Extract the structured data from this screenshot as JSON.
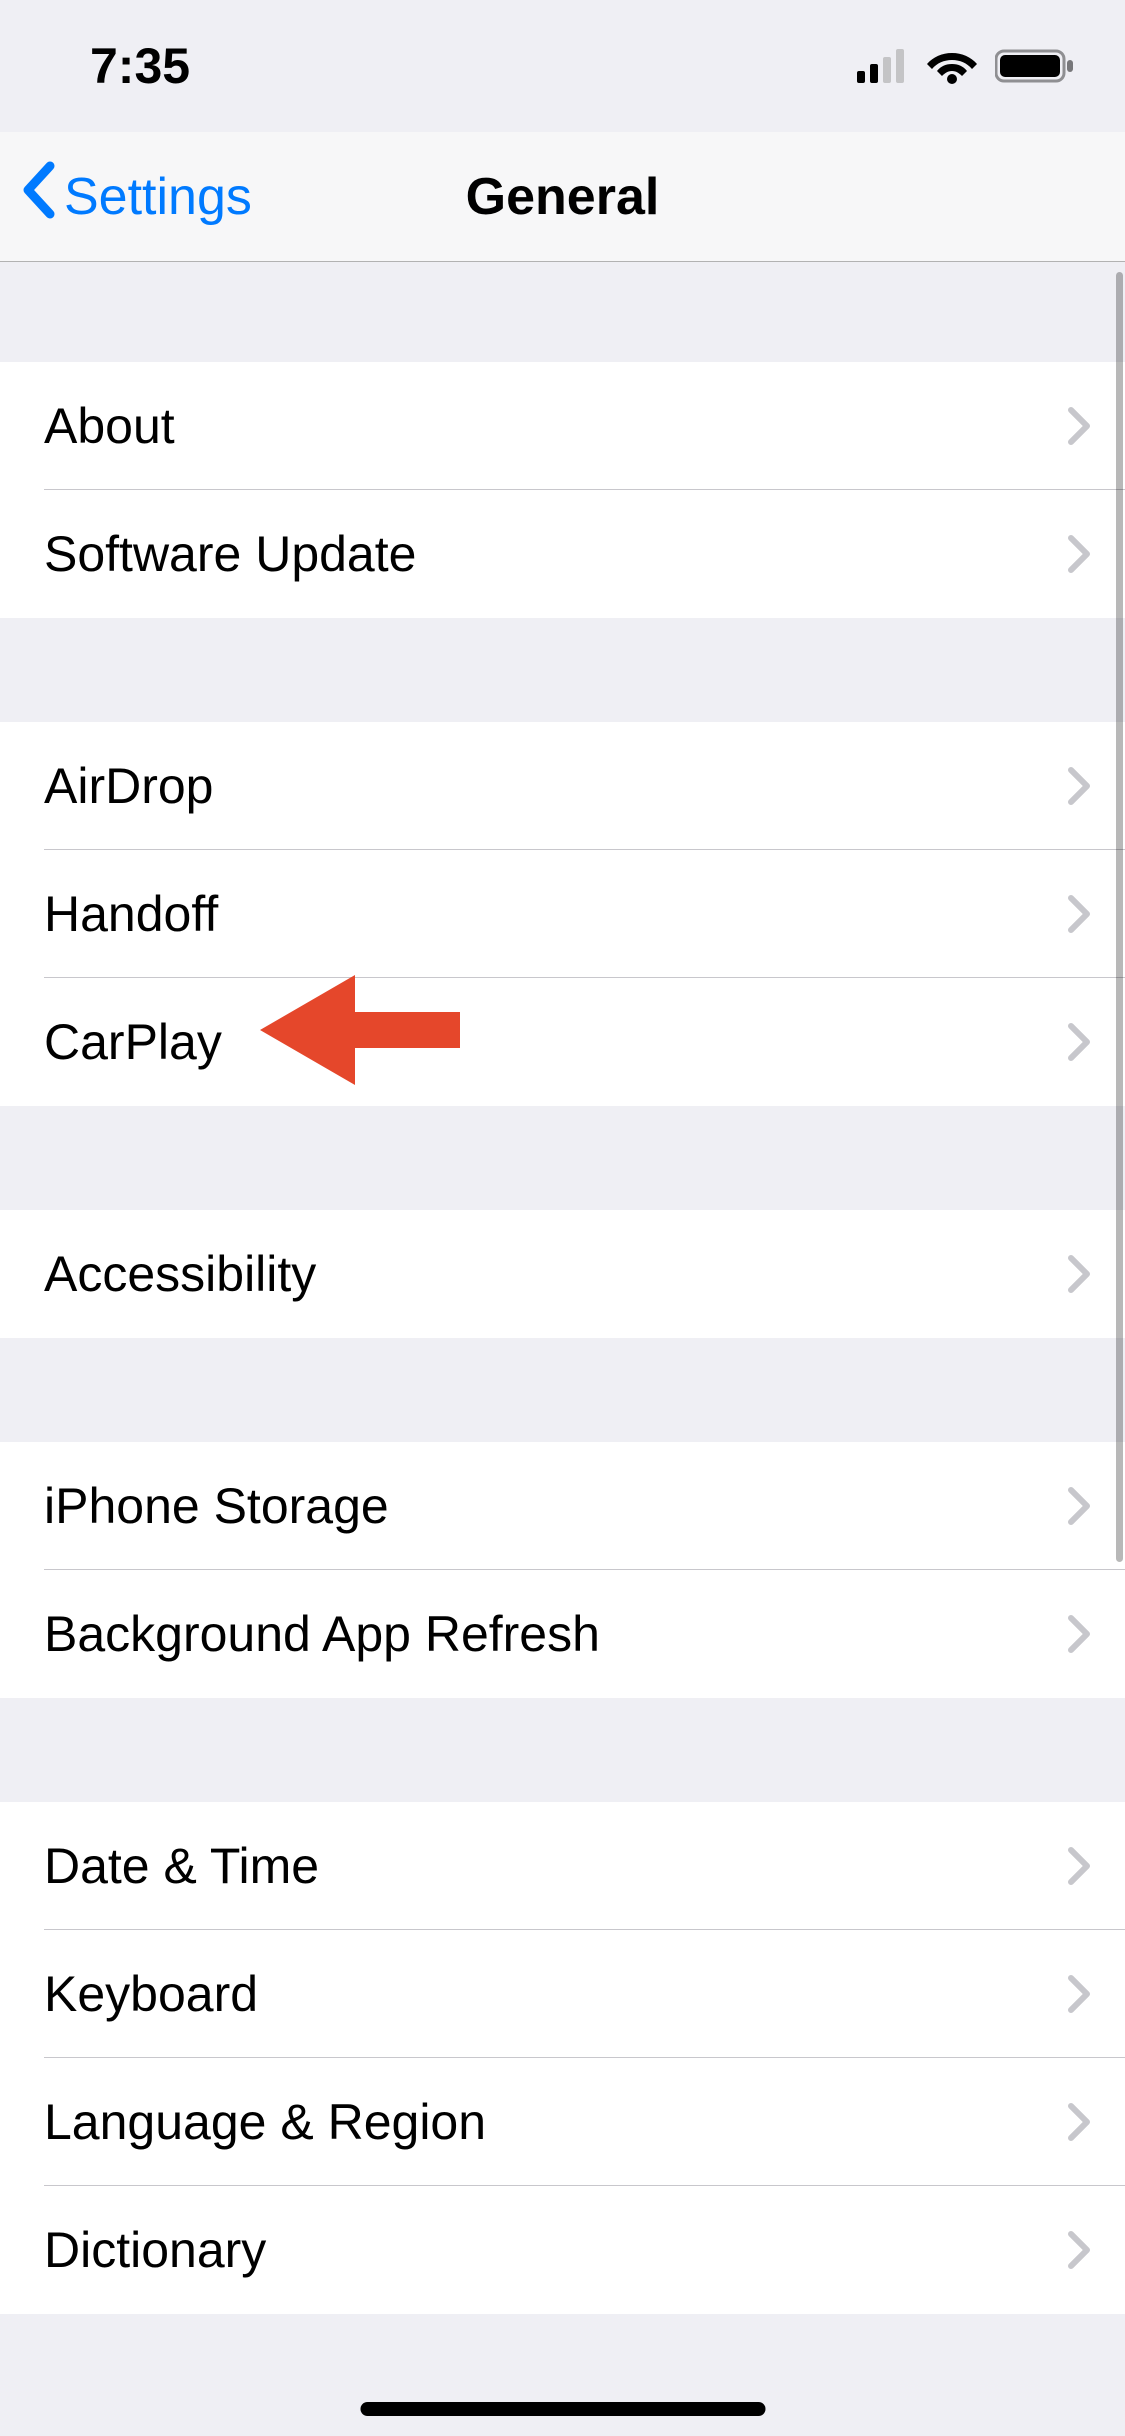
{
  "status": {
    "time": "7:35"
  },
  "nav": {
    "back_label": "Settings",
    "title": "General"
  },
  "groups": [
    [
      {
        "id": "about",
        "label": "About"
      },
      {
        "id": "software-update",
        "label": "Software Update"
      }
    ],
    [
      {
        "id": "airdrop",
        "label": "AirDrop"
      },
      {
        "id": "handoff",
        "label": "Handoff"
      },
      {
        "id": "carplay",
        "label": "CarPlay"
      }
    ],
    [
      {
        "id": "accessibility",
        "label": "Accessibility"
      }
    ],
    [
      {
        "id": "iphone-storage",
        "label": "iPhone Storage"
      },
      {
        "id": "background-app-refresh",
        "label": "Background App Refresh"
      }
    ],
    [
      {
        "id": "date-time",
        "label": "Date & Time"
      },
      {
        "id": "keyboard",
        "label": "Keyboard"
      },
      {
        "id": "language-region",
        "label": "Language & Region"
      },
      {
        "id": "dictionary",
        "label": "Dictionary"
      }
    ]
  ],
  "annotation": {
    "target": "carplay",
    "color": "#e5472b"
  }
}
